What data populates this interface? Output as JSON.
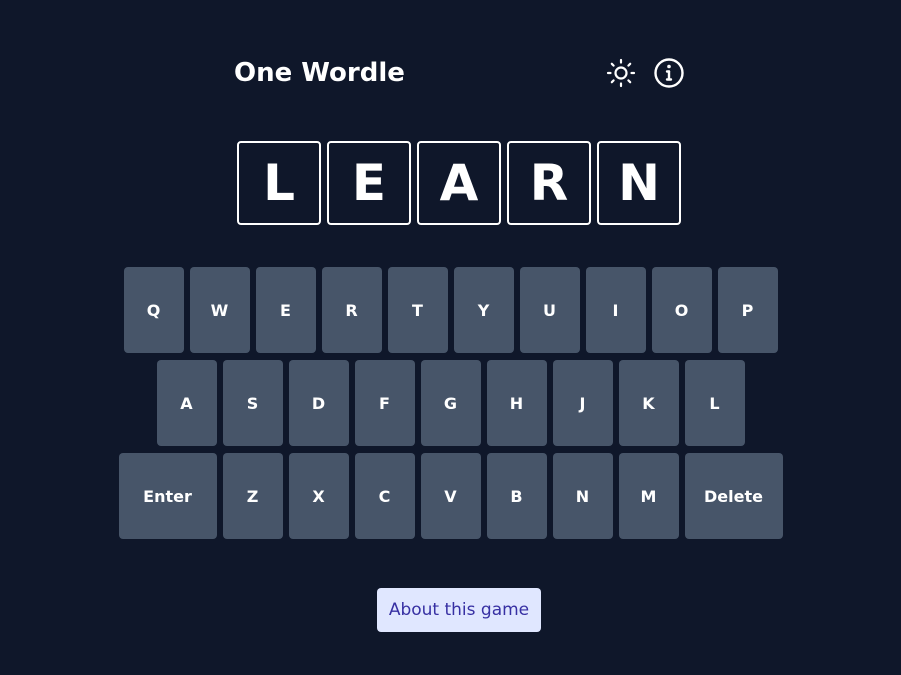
{
  "header": {
    "title": "One Wordle",
    "theme_icon": "sun-icon",
    "info_icon": "info-icon"
  },
  "grid": {
    "tiles": [
      "L",
      "E",
      "A",
      "R",
      "N"
    ]
  },
  "keyboard": {
    "row1": [
      "Q",
      "W",
      "E",
      "R",
      "T",
      "Y",
      "U",
      "I",
      "O",
      "P"
    ],
    "row2": [
      "A",
      "S",
      "D",
      "F",
      "G",
      "H",
      "J",
      "K",
      "L"
    ],
    "row3": [
      "Enter",
      "Z",
      "X",
      "C",
      "V",
      "B",
      "N",
      "M",
      "Delete"
    ]
  },
  "footer": {
    "about_label": "About this game"
  },
  "colors": {
    "background": "#0f172a",
    "key": "#475569",
    "tile_border": "#ffffff",
    "about_bg": "#e0e7ff",
    "about_text": "#3730a3"
  }
}
